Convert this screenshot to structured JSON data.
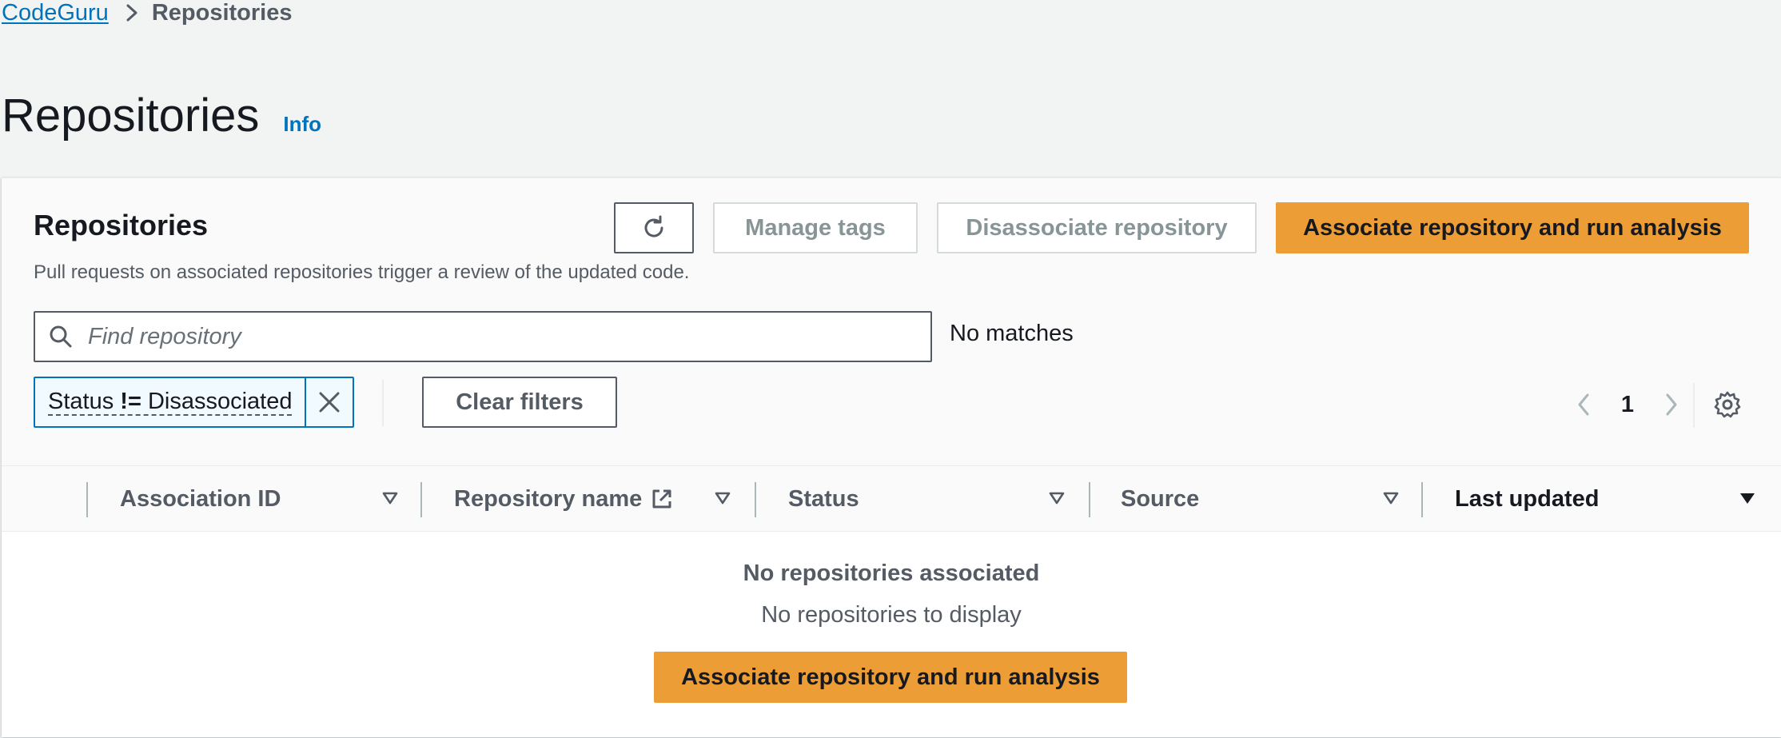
{
  "breadcrumb": {
    "service": "CodeGuru",
    "current": "Repositories"
  },
  "page": {
    "title": "Repositories",
    "info": "Info"
  },
  "container": {
    "title": "Repositories",
    "description": "Pull requests on associated repositories trigger a review of the updated code.",
    "actions": {
      "manage_tags": "Manage tags",
      "disassociate": "Disassociate repository",
      "associate": "Associate repository and run analysis"
    }
  },
  "search": {
    "placeholder": "Find repository",
    "value": "",
    "match_count": "No matches"
  },
  "filter": {
    "property": "Status",
    "operator": "!=",
    "value": "Disassociated",
    "clear_label": "Clear filters"
  },
  "pagination": {
    "current_page": "1"
  },
  "table": {
    "columns": [
      "Association ID",
      "Repository name",
      "Status",
      "Source",
      "Last updated"
    ],
    "sorted_column": "Last updated"
  },
  "empty": {
    "title": "No repositories associated",
    "description": "No repositories to display",
    "action": "Associate repository and run analysis"
  },
  "colors": {
    "primary": "#ec9d36",
    "link": "#0073bb",
    "text": "#16191f",
    "secondary_text": "#545b64",
    "page_bg": "#f2f3f3"
  },
  "icons": {
    "breadcrumb_separator": "chevron-right-icon",
    "refresh": "refresh-icon",
    "search": "search-icon",
    "remove_filter": "close-icon",
    "previous_page": "chevron-left-icon",
    "next_page": "chevron-right-icon",
    "settings": "gear-icon",
    "external": "external-link-icon",
    "sort": "caret-down-icon"
  }
}
